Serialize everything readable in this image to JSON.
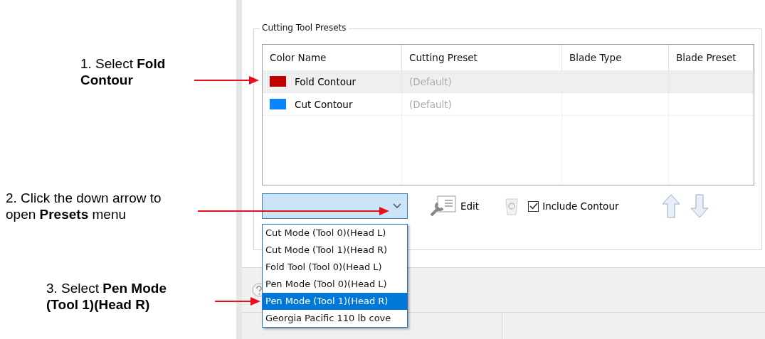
{
  "annotations": [
    {
      "text": "1. Select **Fold Contour**"
    },
    {
      "text": "2. Click the down arrow to open **Presets** menu"
    },
    {
      "text": "3. Select **Pen Mode (Tool 1)(Head R)**"
    }
  ],
  "group": {
    "title": "Cutting Tool Presets",
    "columns": [
      "Color Name",
      "Cutting Preset",
      "Blade Type",
      "Blade Preset"
    ],
    "rows": [
      {
        "color": "#c00000",
        "name": "Fold Contour",
        "cutting_preset": "(Default)",
        "selected": true
      },
      {
        "color": "#0a84ff",
        "name": "Cut Contour",
        "cutting_preset": "(Default)",
        "selected": false
      }
    ],
    "preset_combo": {
      "expanded": true,
      "options": [
        {
          "label": "Cut Mode (Tool 0)(Head L)",
          "selected": false
        },
        {
          "label": "Cut Mode (Tool 1)(Head R)",
          "selected": false
        },
        {
          "label": "Fold Tool (Tool 0)(Head L)",
          "selected": false
        },
        {
          "label": "Pen Mode (Tool 0)(Head L)",
          "selected": false
        },
        {
          "label": "Pen Mode (Tool 1)(Head R)",
          "selected": true
        },
        {
          "label": "Georgia Pacific 110 lb cove",
          "selected": false
        }
      ]
    },
    "edit_button": "Edit",
    "include_contour": {
      "label": "Include Contour",
      "checked": true
    }
  }
}
